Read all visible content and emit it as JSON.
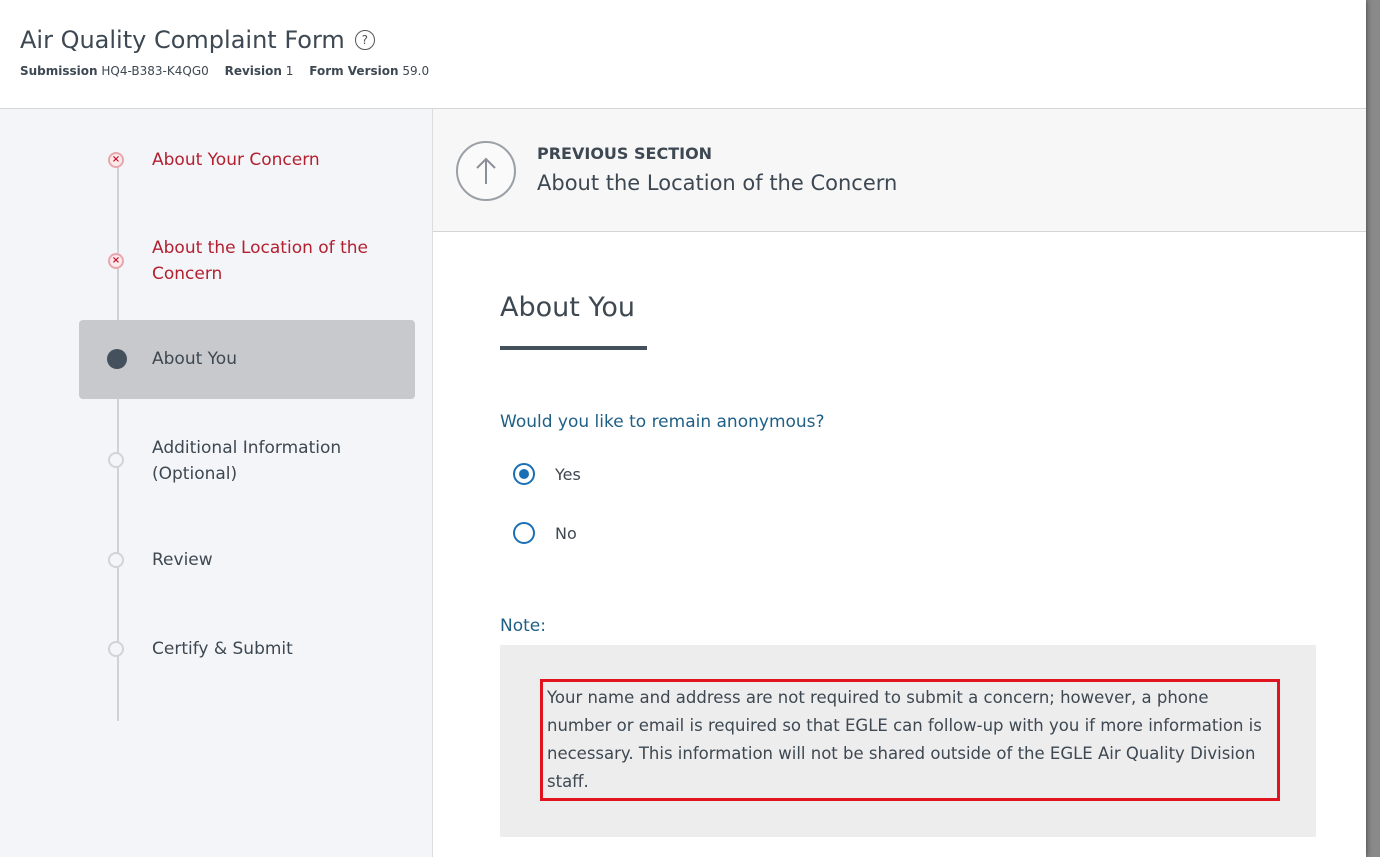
{
  "header": {
    "title": "Air Quality Complaint Form",
    "help_icon": "?",
    "submission_label": "Submission",
    "submission_value": "HQ4-B383-K4QG0",
    "revision_label": "Revision",
    "revision_value": "1",
    "form_version_label": "Form Version",
    "form_version_value": "59.0"
  },
  "sidebar": {
    "steps": [
      {
        "label": "About Your Concern",
        "status": "error"
      },
      {
        "label": "About the Location of the Concern",
        "status": "error"
      },
      {
        "label": "About You",
        "status": "current"
      },
      {
        "label": "Additional Information (Optional)",
        "status": "pending"
      },
      {
        "label": "Review",
        "status": "pending"
      },
      {
        "label": "Certify & Submit",
        "status": "pending"
      }
    ]
  },
  "previous_section": {
    "kicker": "PREVIOUS SECTION",
    "title": "About the Location of the Concern",
    "icon": "arrow-up-icon"
  },
  "main": {
    "section_title": "About You",
    "question": "Would you like to remain anonymous?",
    "options": [
      {
        "label": "Yes",
        "selected": true
      },
      {
        "label": "No",
        "selected": false
      }
    ],
    "note_label": "Note:",
    "note_text": "Your name and address are not required to submit a concern; however, a phone number or email is required so that EGLE can follow-up with you if more information is necessary. This information will not be shared outside of the EGLE Air Quality Division staff."
  },
  "colors": {
    "error": "#b3202f",
    "accent": "#1a6fb5",
    "question": "#1f5f86",
    "highlight_border": "#e0141e"
  }
}
